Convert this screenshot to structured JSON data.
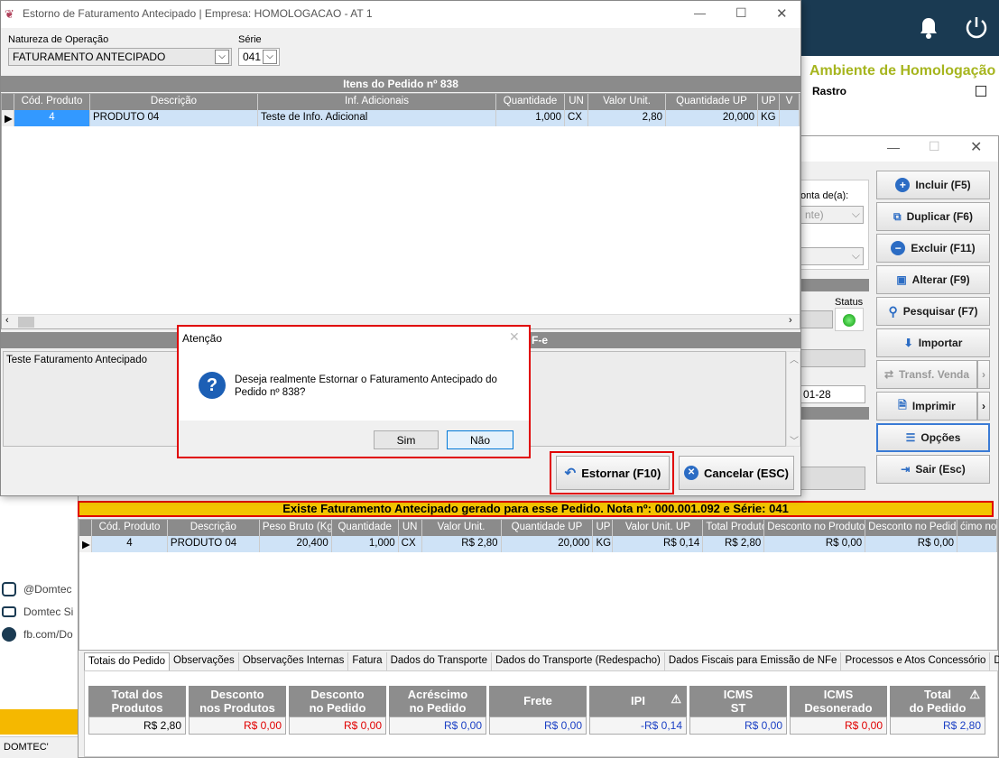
{
  "background": {
    "env_label": "Ambiente de Homologação",
    "rastro_label": "Rastro",
    "social": [
      "@Domtec",
      "Domtec Si",
      "fb.com/Do"
    ],
    "footer": "DOMTEC'"
  },
  "window2": {
    "conta_label": "onta de(a):",
    "conta_value": "nte)",
    "status_label": "Status",
    "date_fragment": "01-28",
    "side_buttons": [
      "Incluir (F5)",
      "Duplicar (F6)",
      "Excluir (F11)",
      "Alterar (F9)",
      "Pesquisar (F7)",
      "Importar",
      "Transf. Venda",
      "Imprimir",
      "Opções",
      "Sair (Esc)"
    ],
    "banner": "Existe Faturamento Antecipado gerado para esse Pedido. Nota nº: 000.001.092 e Série: 041",
    "grid": {
      "headers": [
        "Cód. Produto",
        "Descrição",
        "Peso Bruto (Kg)",
        "Quantidade",
        "UN",
        "Valor Unit.",
        "Quantidade UP",
        "UP",
        "Valor Unit. UP",
        "Total Produto",
        "Desconto no Produto",
        "Desconto no Pedido",
        "ćimo no I"
      ],
      "row": [
        "4",
        "PRODUTO 04",
        "20,400",
        "1,000",
        "CX",
        "R$ 2,80",
        "20,000",
        "KG",
        "R$ 0,14",
        "R$ 2,80",
        "R$ 0,00",
        "R$ 0,00",
        ""
      ]
    },
    "tabs": [
      "Totais do Pedido",
      "Observações",
      "Observações Internas",
      "Fatura",
      "Dados do Transporte",
      "Dados do Transporte (Redespacho)",
      "Dados Fiscais para Emissão de NFe",
      "Processos e Atos Concessório",
      "D"
    ],
    "totals": [
      {
        "label1": "Total dos",
        "label2": "Produtos",
        "value": "R$ 2,80",
        "color": "#000000"
      },
      {
        "label1": "Desconto",
        "label2": "nos Produtos",
        "value": "R$ 0,00",
        "color": "#e00000"
      },
      {
        "label1": "Desconto",
        "label2": "no Pedido",
        "value": "R$ 0,00",
        "color": "#e00000"
      },
      {
        "label1": "Acréscimo",
        "label2": "no Pedido",
        "value": "R$ 0,00",
        "color": "#1a3fc4"
      },
      {
        "label1": "Frete",
        "label2": "",
        "value": "R$ 0,00",
        "color": "#1a3fc4"
      },
      {
        "label1": "IPI",
        "label2": "",
        "value": "-R$ 0,14",
        "color": "#1a3fc4"
      },
      {
        "label1": "ICMS",
        "label2": "ST",
        "value": "R$ 0,00",
        "color": "#1a3fc4"
      },
      {
        "label1": "ICMS",
        "label2": "Desonerado",
        "value": "R$ 0,00",
        "color": "#e00000"
      },
      {
        "label1": "Total",
        "label2": "do Pedido",
        "value": "R$ 2,80",
        "color": "#1a3fc4"
      }
    ]
  },
  "window1": {
    "title": "Estorno de Faturamento Antecipado | Empresa: HOMOLOGACAO - AT 1",
    "natureza_label": "Natureza de Operação",
    "natureza_value": "FATURAMENTO ANTECIPADO",
    "serie_label": "Série",
    "serie_value": "041",
    "items_header": "Itens do Pedido nº 838",
    "grid": {
      "headers": [
        "Cód. Produto",
        "Descrição",
        "Inf. Adicionais",
        "Quantidade",
        "UN",
        "Valor Unit.",
        "Quantidade UP",
        "UP",
        "V"
      ],
      "row": [
        "4",
        "PRODUTO 04",
        "Teste de Info. Adicional",
        "1,000",
        "CX",
        "2,80",
        "20,000",
        "KG",
        ""
      ]
    },
    "section2_fragment": "F-e",
    "memo": "Teste Faturamento Antecipado",
    "estornar": "Estornar (F10)",
    "cancelar": "Cancelar (ESC)"
  },
  "dialog": {
    "title": "Atenção",
    "message_line1": "Deseja realmente Estornar o Faturamento Antecipado do",
    "message_line2": "Pedido nº 838?",
    "sim": "Sim",
    "nao": "Não"
  }
}
